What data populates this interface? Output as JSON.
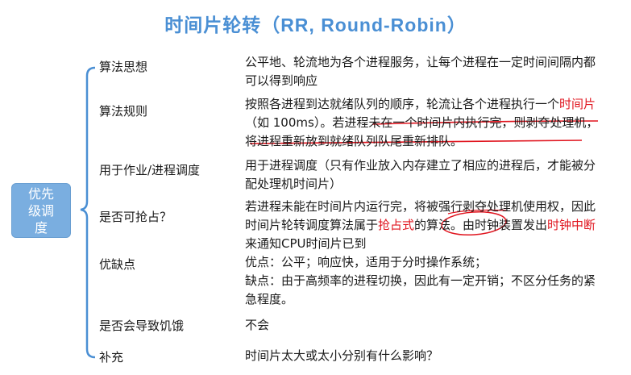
{
  "title": {
    "zh": "时间片轮转（",
    "en": "RR, Round-Robin",
    "close": "）"
  },
  "side_box": {
    "label": "优先级调度"
  },
  "rows": [
    {
      "label": "算法思想",
      "desc": "公平地、轮流地为各个进程服务，让每个进程在一定时间间隔内都可以得到响应"
    },
    {
      "label": "算法规则",
      "desc_parts": {
        "a": "按照各进程到达就绪队列的顺序，轮流让各个进程执行一个",
        "b": "时间片",
        "c": "（如 100ms）。若进程未在一个时间片内执行完，则剥夺处理机，将进程重新放到就绪队列队尾重新排队。"
      }
    },
    {
      "label": "用于作业/进程调度",
      "desc": "用于进程调度（只有作业放入内存建立了相应的进程后，才能被分配处理机时间片）"
    },
    {
      "label": "是否可抢占？",
      "desc_parts": {
        "a": "若进程未能在时间片内运行完，将被强行剥夺处理机使用权，因此时间片轮转调度算法属于",
        "b": "抢占式",
        "c": "的算法。由时钟装置发出",
        "d": "时钟中断",
        "e": "来通知CPU时间片已到"
      }
    },
    {
      "label": "优缺点",
      "desc_lines": {
        "pros": "优点：公平；响应快，适用于分时操作系统；",
        "cons": "缺点：由于高频率的进程切换，因此有一定开销；不区分任务的紧急程度。"
      }
    },
    {
      "label": "是否会导致饥饿",
      "desc": "不会"
    },
    {
      "label": "补充",
      "desc": "时间片太大或太小分别有什么影响？"
    }
  ],
  "colors": {
    "title": "#4a8fd4",
    "side_box": "#7aaee0",
    "brace": "#4a8fd4",
    "highlight": "#e0141e"
  }
}
